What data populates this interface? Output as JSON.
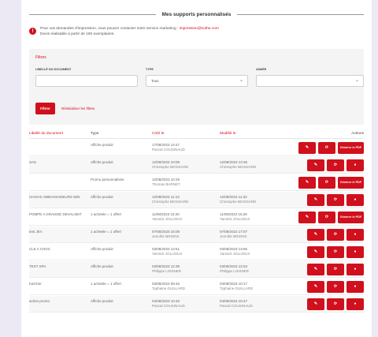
{
  "section": {
    "title": "Mes supports personnalisés"
  },
  "info": {
    "line1_prefix": "Pour vos demandes d'impression, vous pouvez contacter notre service marketing : ",
    "email": "impression@sothe.com",
    "line2": "Devis réalisable à partir de 100 exemplaires."
  },
  "filters": {
    "title": "Filtres",
    "libelle_label": "Libellé du document",
    "libelle_value": "",
    "type_label": "Type",
    "type_value": "Tous",
    "annee_label": "Année",
    "annee_value": "",
    "filter_button": "Filtrer",
    "reset_link": "Réinitialiser les filtres"
  },
  "table": {
    "headers": {
      "libelle": "Libellé du document",
      "type": "Type",
      "cree": "Créé le",
      "modifie": "Modifié le",
      "actions": "Actions"
    },
    "generate_label": "Générer le PDF",
    "rows": [
      {
        "libelle": "",
        "type": "Affiche produit",
        "cree_date": "17/08/2023 14:47",
        "cree_user": "Pascal COUSINAUD",
        "modif_date": "",
        "modif_user": "",
        "generate": true
      },
      {
        "libelle": "SAS",
        "type": "Affiche produit",
        "cree_date": "12/08/2023 10:08",
        "cree_user": "Christophe BIOSSARD",
        "modif_date": "12/08/2023 13:36",
        "modif_user": "Christophe BIOSSARD",
        "generate": false
      },
      {
        "libelle": "",
        "type": "Promo personnalisée",
        "cree_date": "12/08/2023 10:29",
        "cree_user": "Thomas BARNET",
        "modif_date": "",
        "modif_user": "",
        "generate": true
      },
      {
        "libelle": "CHIVAS AMBASSADEURS 60N",
        "type": "Affiche produit",
        "cree_date": "12/08/2023 11:13",
        "cree_user": "Christophe BIOSSARD",
        "modif_date": "12/08/2023 11:32",
        "modif_user": "Christophe BIOSSARD",
        "generate": false
      },
      {
        "libelle": "POMPE A GRAISSE DEVALSEIT",
        "type": "1 achetée = 1 offert",
        "cree_date": "11/08/2023 15:20",
        "cree_user": "Yannick JOLIJOUX",
        "modif_date": "11/08/2023 15:26",
        "modif_user": "Yannick JOLIJOUX",
        "generate": true
      },
      {
        "libelle": "test JEA",
        "type": "1 achetée = 1 offert",
        "cree_date": "07/08/2023 16:08",
        "cree_user": "Jennifer BRIONS",
        "modif_date": "07/08/2023 17:07",
        "modif_user": "Jennifer BRIONS",
        "generate": false
      },
      {
        "libelle": "CLE A CHOC",
        "type": "Affiche produit",
        "cree_date": "03/08/2023 13:51",
        "cree_user": "Yannick JOLIJOUX",
        "modif_date": "03/08/2023 13:56",
        "modif_user": "Yannick JOLIJOUX",
        "generate": false
      },
      {
        "libelle": "TEST SPA",
        "type": "Affiche produit",
        "cree_date": "03/08/2023 12:39",
        "cree_user": "Philippe LOISNER",
        "modif_date": "03/08/2023 12:53",
        "modif_user": "Philippe LOISNER",
        "generate": false
      },
      {
        "libelle": "Karcher",
        "type": "1 achetée = 1 offert",
        "cree_date": "03/08/2023 09:45",
        "cree_user": "Typhaine GUILLARD",
        "modif_date": "03/08/2023 10:17",
        "modif_user": "Typhaine GUILLARD",
        "generate": false
      },
      {
        "libelle": "action promo",
        "type": "Affiche produit",
        "cree_date": "04/08/2023 10:46",
        "cree_user": "Pascal COUSINAUD",
        "modif_date": "04/08/2023 10:47",
        "modif_user": "Pascal COUSINAUD",
        "generate": false
      }
    ]
  },
  "colors": {
    "accent": "#d0101c",
    "background": "#ece9f5"
  },
  "icons": {
    "info": "info-icon",
    "edit": "edit-icon",
    "duplicate": "duplicate-icon",
    "delete": "delete-icon"
  }
}
